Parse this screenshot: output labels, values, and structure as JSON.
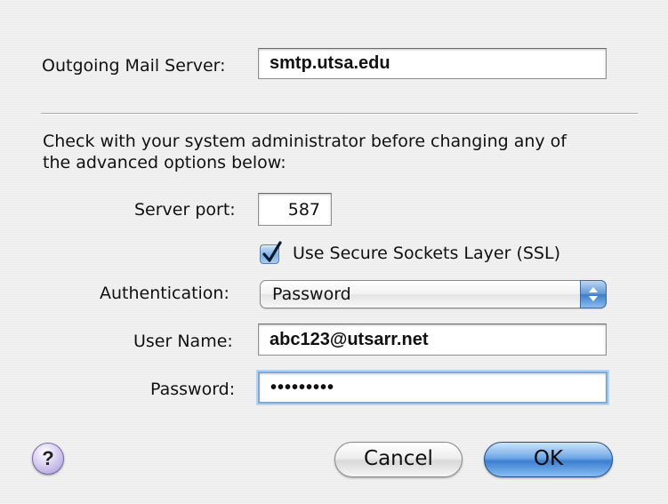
{
  "outgoing_server": {
    "label": "Outgoing Mail Server:",
    "value": "smtp.utsa.edu"
  },
  "notice": {
    "line1": "Check with your system administrator before changing any of",
    "line2": "the advanced options below:"
  },
  "server_port": {
    "label": "Server port:",
    "value": "587"
  },
  "ssl": {
    "label": "Use Secure Sockets Layer (SSL)",
    "checked": true
  },
  "authentication": {
    "label": "Authentication:",
    "selected": "Password"
  },
  "user_name": {
    "label": "User Name:",
    "value": "abc123@utsarr.net"
  },
  "password": {
    "label": "Password:",
    "value": "•••••••••"
  },
  "buttons": {
    "help": "?",
    "cancel": "Cancel",
    "ok": "OK"
  },
  "colors": {
    "accent": "#3c7fd0",
    "help_button": "#a796d6",
    "background": "#ececec"
  }
}
